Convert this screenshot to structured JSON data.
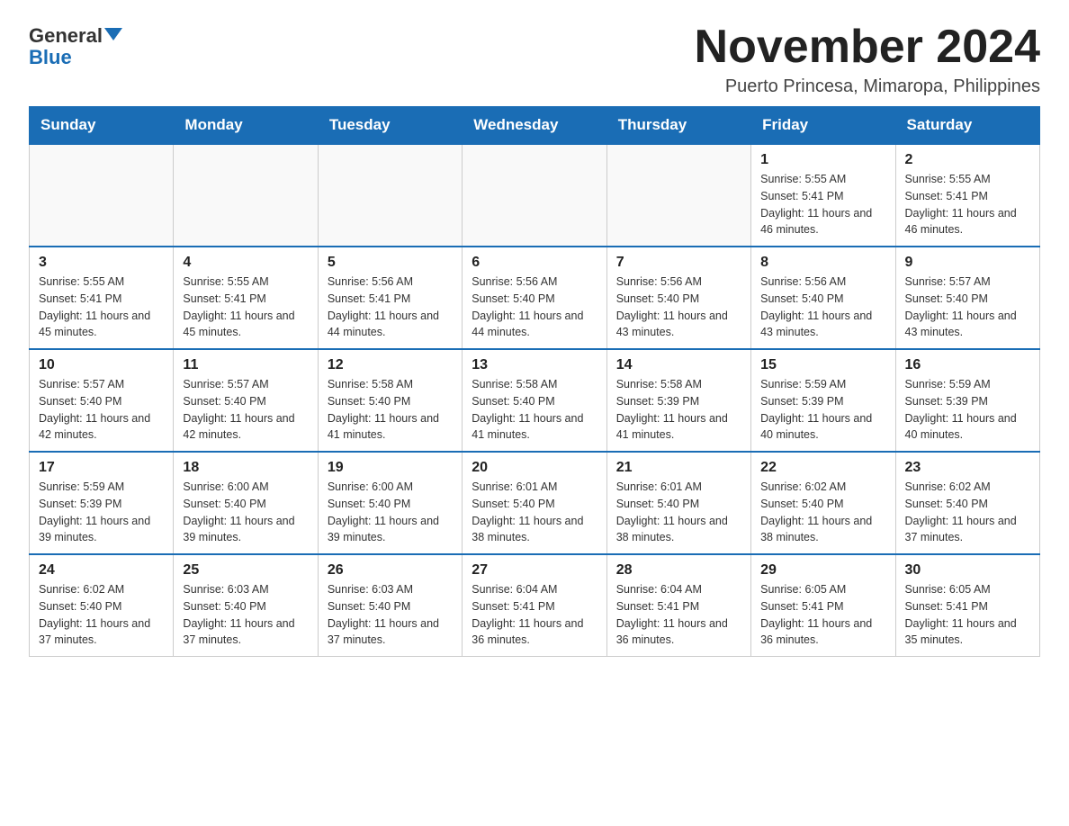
{
  "logo": {
    "general": "General",
    "blue": "Blue"
  },
  "title": "November 2024",
  "subtitle": "Puerto Princesa, Mimaropa, Philippines",
  "days_of_week": [
    "Sunday",
    "Monday",
    "Tuesday",
    "Wednesday",
    "Thursday",
    "Friday",
    "Saturday"
  ],
  "weeks": [
    [
      {
        "day": "",
        "info": ""
      },
      {
        "day": "",
        "info": ""
      },
      {
        "day": "",
        "info": ""
      },
      {
        "day": "",
        "info": ""
      },
      {
        "day": "",
        "info": ""
      },
      {
        "day": "1",
        "info": "Sunrise: 5:55 AM\nSunset: 5:41 PM\nDaylight: 11 hours and 46 minutes."
      },
      {
        "day": "2",
        "info": "Sunrise: 5:55 AM\nSunset: 5:41 PM\nDaylight: 11 hours and 46 minutes."
      }
    ],
    [
      {
        "day": "3",
        "info": "Sunrise: 5:55 AM\nSunset: 5:41 PM\nDaylight: 11 hours and 45 minutes."
      },
      {
        "day": "4",
        "info": "Sunrise: 5:55 AM\nSunset: 5:41 PM\nDaylight: 11 hours and 45 minutes."
      },
      {
        "day": "5",
        "info": "Sunrise: 5:56 AM\nSunset: 5:41 PM\nDaylight: 11 hours and 44 minutes."
      },
      {
        "day": "6",
        "info": "Sunrise: 5:56 AM\nSunset: 5:40 PM\nDaylight: 11 hours and 44 minutes."
      },
      {
        "day": "7",
        "info": "Sunrise: 5:56 AM\nSunset: 5:40 PM\nDaylight: 11 hours and 43 minutes."
      },
      {
        "day": "8",
        "info": "Sunrise: 5:56 AM\nSunset: 5:40 PM\nDaylight: 11 hours and 43 minutes."
      },
      {
        "day": "9",
        "info": "Sunrise: 5:57 AM\nSunset: 5:40 PM\nDaylight: 11 hours and 43 minutes."
      }
    ],
    [
      {
        "day": "10",
        "info": "Sunrise: 5:57 AM\nSunset: 5:40 PM\nDaylight: 11 hours and 42 minutes."
      },
      {
        "day": "11",
        "info": "Sunrise: 5:57 AM\nSunset: 5:40 PM\nDaylight: 11 hours and 42 minutes."
      },
      {
        "day": "12",
        "info": "Sunrise: 5:58 AM\nSunset: 5:40 PM\nDaylight: 11 hours and 41 minutes."
      },
      {
        "day": "13",
        "info": "Sunrise: 5:58 AM\nSunset: 5:40 PM\nDaylight: 11 hours and 41 minutes."
      },
      {
        "day": "14",
        "info": "Sunrise: 5:58 AM\nSunset: 5:39 PM\nDaylight: 11 hours and 41 minutes."
      },
      {
        "day": "15",
        "info": "Sunrise: 5:59 AM\nSunset: 5:39 PM\nDaylight: 11 hours and 40 minutes."
      },
      {
        "day": "16",
        "info": "Sunrise: 5:59 AM\nSunset: 5:39 PM\nDaylight: 11 hours and 40 minutes."
      }
    ],
    [
      {
        "day": "17",
        "info": "Sunrise: 5:59 AM\nSunset: 5:39 PM\nDaylight: 11 hours and 39 minutes."
      },
      {
        "day": "18",
        "info": "Sunrise: 6:00 AM\nSunset: 5:40 PM\nDaylight: 11 hours and 39 minutes."
      },
      {
        "day": "19",
        "info": "Sunrise: 6:00 AM\nSunset: 5:40 PM\nDaylight: 11 hours and 39 minutes."
      },
      {
        "day": "20",
        "info": "Sunrise: 6:01 AM\nSunset: 5:40 PM\nDaylight: 11 hours and 38 minutes."
      },
      {
        "day": "21",
        "info": "Sunrise: 6:01 AM\nSunset: 5:40 PM\nDaylight: 11 hours and 38 minutes."
      },
      {
        "day": "22",
        "info": "Sunrise: 6:02 AM\nSunset: 5:40 PM\nDaylight: 11 hours and 38 minutes."
      },
      {
        "day": "23",
        "info": "Sunrise: 6:02 AM\nSunset: 5:40 PM\nDaylight: 11 hours and 37 minutes."
      }
    ],
    [
      {
        "day": "24",
        "info": "Sunrise: 6:02 AM\nSunset: 5:40 PM\nDaylight: 11 hours and 37 minutes."
      },
      {
        "day": "25",
        "info": "Sunrise: 6:03 AM\nSunset: 5:40 PM\nDaylight: 11 hours and 37 minutes."
      },
      {
        "day": "26",
        "info": "Sunrise: 6:03 AM\nSunset: 5:40 PM\nDaylight: 11 hours and 37 minutes."
      },
      {
        "day": "27",
        "info": "Sunrise: 6:04 AM\nSunset: 5:41 PM\nDaylight: 11 hours and 36 minutes."
      },
      {
        "day": "28",
        "info": "Sunrise: 6:04 AM\nSunset: 5:41 PM\nDaylight: 11 hours and 36 minutes."
      },
      {
        "day": "29",
        "info": "Sunrise: 6:05 AM\nSunset: 5:41 PM\nDaylight: 11 hours and 36 minutes."
      },
      {
        "day": "30",
        "info": "Sunrise: 6:05 AM\nSunset: 5:41 PM\nDaylight: 11 hours and 35 minutes."
      }
    ]
  ]
}
